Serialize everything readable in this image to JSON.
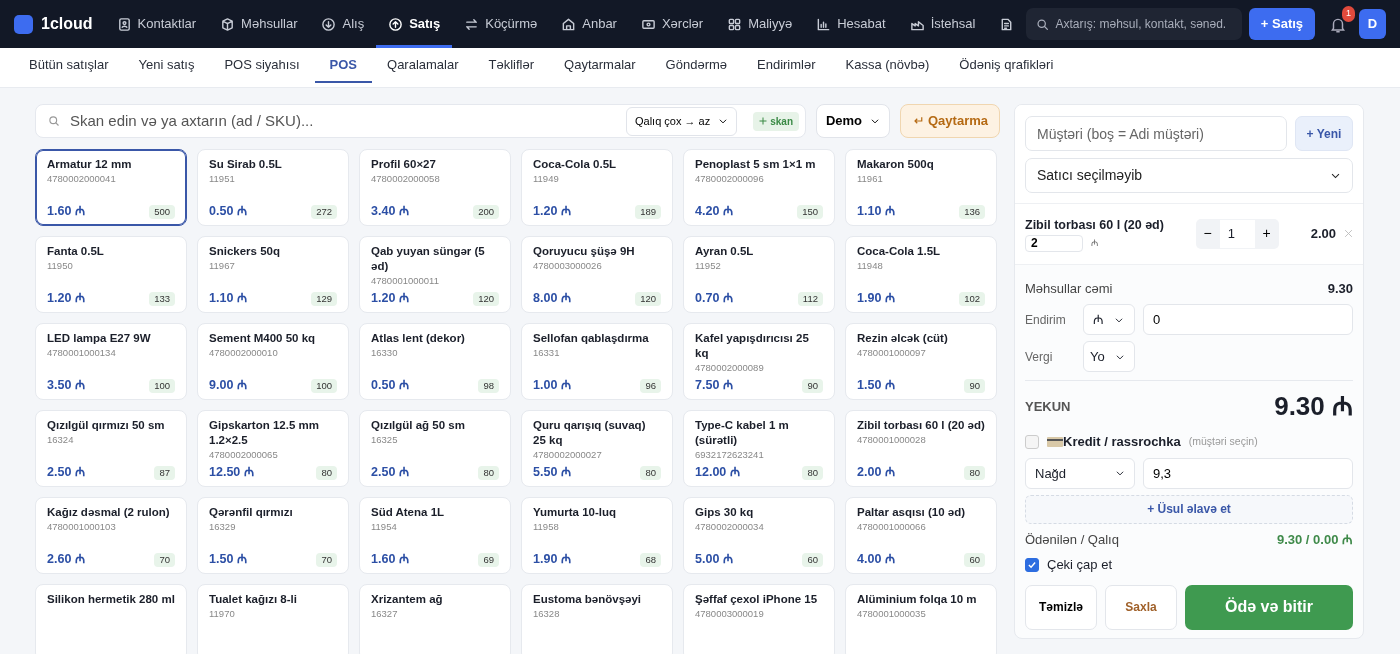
{
  "topbar": {
    "logo": "1cloud",
    "nav": [
      {
        "label": "Kontaktlar",
        "selected": false
      },
      {
        "label": "Məhsullar",
        "selected": false
      },
      {
        "label": "Alış",
        "selected": false
      },
      {
        "label": "Satış",
        "selected": true
      },
      {
        "label": "Köçürmə",
        "selected": false
      },
      {
        "label": "Anbar",
        "selected": false
      },
      {
        "label": "Xərclər",
        "selected": false
      },
      {
        "label": "Maliyyə",
        "selected": false
      },
      {
        "label": "Hesabat",
        "selected": false
      },
      {
        "label": "İstehsal",
        "selected": false
      },
      {
        "selected": false
      }
    ],
    "search": {
      "placeholder": "Axtarış: məhsul, kontakt, sənəd."
    },
    "new_button": "+ Satış",
    "notifications": "1",
    "avatar": "D"
  },
  "subnav": [
    {
      "label": "Bütün satışlar",
      "selected": false
    },
    {
      "label": "Yeni satış",
      "selected": false
    },
    {
      "label": "POS siyahısı",
      "selected": false
    },
    {
      "label": "POS",
      "selected": true
    },
    {
      "label": "Qaralamalar",
      "selected": false
    },
    {
      "label": "Təkliflər",
      "selected": false
    },
    {
      "label": "Qaytarmalar",
      "selected": false
    },
    {
      "label": "Göndərmə",
      "selected": false
    },
    {
      "label": "Endirimlər",
      "selected": false
    },
    {
      "label": "Kassa (növbə)",
      "selected": false
    },
    {
      "label": "Ödəniş qrafikləri",
      "selected": false
    }
  ],
  "toolbar": {
    "search": {
      "placeholder": "Skan edin və ya axtarın (ad / SKU)..."
    },
    "sort": "Qalıq çox → az",
    "scan": "skan",
    "warehouse": "Demo",
    "return_button": "Qaytarma"
  },
  "products": [
    {
      "name": "Armatur 12 mm",
      "sku": "4780002000041",
      "price": "1.60 ₼",
      "stock": "500",
      "selected": true
    },
    {
      "name": "Su Sirab 0.5L",
      "sku": "11951",
      "price": "0.50 ₼",
      "stock": "272",
      "selected": false
    },
    {
      "name": "Profil 60×27",
      "sku": "4780002000058",
      "price": "3.40 ₼",
      "stock": "200",
      "selected": false
    },
    {
      "name": "Coca-Cola 0.5L",
      "sku": "11949",
      "price": "1.20 ₼",
      "stock": "189",
      "selected": false
    },
    {
      "name": "Penoplast 5 sm 1×1 m",
      "sku": "4780002000096",
      "price": "4.20 ₼",
      "stock": "150",
      "selected": false
    },
    {
      "name": "Makaron 500q",
      "sku": "11961",
      "price": "1.10 ₼",
      "stock": "136",
      "selected": false
    },
    {
      "name": "Fanta 0.5L",
      "sku": "11950",
      "price": "1.20 ₼",
      "stock": "133",
      "selected": false
    },
    {
      "name": "Snickers 50q",
      "sku": "11967",
      "price": "1.10 ₼",
      "stock": "129",
      "selected": false
    },
    {
      "name": "Qab yuyan süngər (5 əd)",
      "sku": "4780001000011",
      "price": "1.20 ₼",
      "stock": "120",
      "selected": false
    },
    {
      "name": "Qoruyucu şüşə 9H",
      "sku": "4780003000026",
      "price": "8.00 ₼",
      "stock": "120",
      "selected": false
    },
    {
      "name": "Ayran 0.5L",
      "sku": "11952",
      "price": "0.70 ₼",
      "stock": "112",
      "selected": false
    },
    {
      "name": "Coca-Cola 1.5L",
      "sku": "11948",
      "price": "1.90 ₼",
      "stock": "102",
      "selected": false
    },
    {
      "name": "LED lampa E27 9W",
      "sku": "4780001000134",
      "price": "3.50 ₼",
      "stock": "100",
      "selected": false
    },
    {
      "name": "Sement M400 50 kq",
      "sku": "4780002000010",
      "price": "9.00 ₼",
      "stock": "100",
      "selected": false
    },
    {
      "name": "Atlas lent (dekor)",
      "sku": "16330",
      "price": "0.50 ₼",
      "stock": "98",
      "selected": false
    },
    {
      "name": "Sellofan qablaşdırma",
      "sku": "16331",
      "price": "1.00 ₼",
      "stock": "96",
      "selected": false
    },
    {
      "name": "Kafel yapışdırıcısı 25 kq",
      "sku": "4780002000089",
      "price": "7.50 ₼",
      "stock": "90",
      "selected": false
    },
    {
      "name": "Rezin əlcək (cüt)",
      "sku": "4780001000097",
      "price": "1.50 ₼",
      "stock": "90",
      "selected": false
    },
    {
      "name": "Qızılgül qırmızı 50 sm",
      "sku": "16324",
      "price": "2.50 ₼",
      "stock": "87",
      "selected": false
    },
    {
      "name": "Gipskarton 12.5 mm 1.2×2.5",
      "sku": "4780002000065",
      "price": "12.50 ₼",
      "stock": "80",
      "selected": false
    },
    {
      "name": "Qızılgül ağ 50 sm",
      "sku": "16325",
      "price": "2.50 ₼",
      "stock": "80",
      "selected": false
    },
    {
      "name": "Quru qarışıq (suvaq) 25 kq",
      "sku": "4780002000027",
      "price": "5.50 ₼",
      "stock": "80",
      "selected": false
    },
    {
      "name": "Type-C kabel 1 m (sürətli)",
      "sku": "6932172623241",
      "price": "12.00 ₼",
      "stock": "80",
      "selected": false
    },
    {
      "name": "Zibil torbası 60 l (20 əd)",
      "sku": "4780001000028",
      "price": "2.00 ₼",
      "stock": "80",
      "selected": false
    },
    {
      "name": "Kağız dəsmal (2 rulon)",
      "sku": "4780001000103",
      "price": "2.60 ₼",
      "stock": "70",
      "selected": false
    },
    {
      "name": "Qərənfil qırmızı",
      "sku": "16329",
      "price": "1.50 ₼",
      "stock": "70",
      "selected": false
    },
    {
      "name": "Süd Atena 1L",
      "sku": "11954",
      "price": "1.60 ₼",
      "stock": "69",
      "selected": false
    },
    {
      "name": "Yumurta 10-luq",
      "sku": "11958",
      "price": "1.90 ₼",
      "stock": "68",
      "selected": false
    },
    {
      "name": "Gips 30 kq",
      "sku": "4780002000034",
      "price": "5.00 ₼",
      "stock": "60",
      "selected": false
    },
    {
      "name": "Paltar asqısı (10 əd)",
      "sku": "4780001000066",
      "price": "4.00 ₼",
      "stock": "60",
      "selected": false
    },
    {
      "name": "Silikon hermetik 280 ml",
      "selected": false
    },
    {
      "name": "Tualet kağızı 8-li",
      "sku": "11970",
      "selected": false
    },
    {
      "name": "Xrizantem ağ",
      "sku": "16327",
      "selected": false
    },
    {
      "name": "Eustoma bənövşəyi",
      "sku": "16328",
      "selected": false
    },
    {
      "name": "Şəffaf çexol iPhone 15",
      "sku": "4780003000019",
      "selected": false
    },
    {
      "name": "Alüminium folqa 10 m",
      "sku": "4780001000035",
      "selected": false
    }
  ],
  "cart": {
    "customer": {
      "placeholder": "Müştəri (boş = Adi müştəri)"
    },
    "new_customer": "+ Yeni",
    "seller": "Satıcı seçilməyib",
    "lines": [
      {
        "name": "Zibil torbası 60 l (20 əd)",
        "price": "2",
        "currency": "₼",
        "decrease": "−",
        "qty": "1",
        "increase": "+",
        "total": "2.00"
      }
    ],
    "subtotal_label": "Məhsullar cəmi",
    "subtotal": "9.30",
    "discount_label": "Endirim",
    "discount_unit": "₼",
    "discount": "0",
    "tax_label": "Vergi",
    "tax": "Yo",
    "total_label": "YEKUN",
    "total": "9.30 ₼",
    "credit": {
      "label": "Kredit / rassrochka",
      "hint": "(müştəri seçin)",
      "checked": false
    },
    "payment": {
      "method": "Nağd",
      "amount": "9,3"
    },
    "add_method": "+ Üsul əlavə et",
    "paid_label": "Ödənilən / Qalıq",
    "paid": "9.30 / 0.00 ₼",
    "print": {
      "label": "Çeki çap et",
      "checked": true
    },
    "buttons": {
      "clear": "Təmizlə",
      "hold": "Saxla",
      "pay": "Ödə və bitir"
    }
  }
}
